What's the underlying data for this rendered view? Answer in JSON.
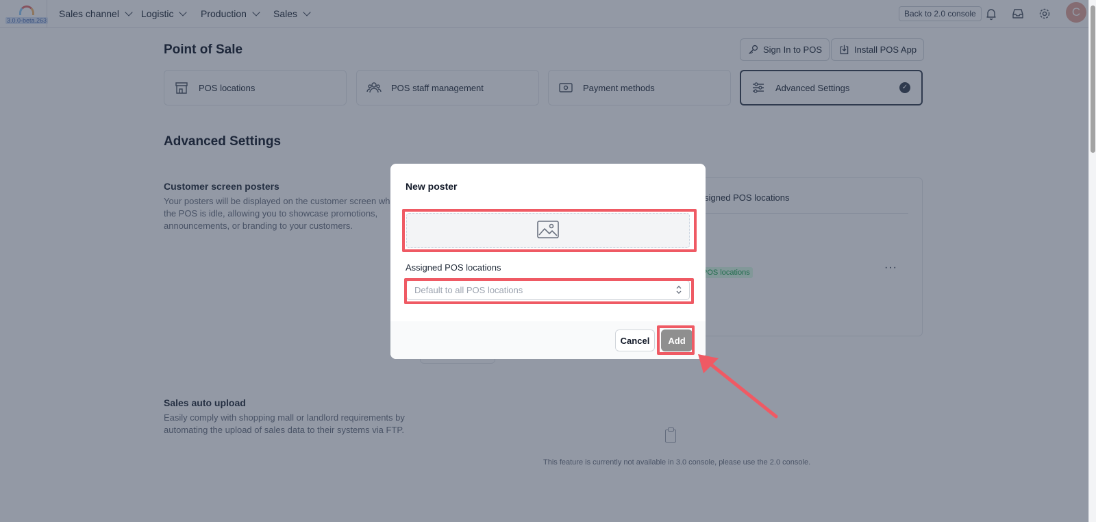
{
  "topbar": {
    "version": "3.0.0-beta.263",
    "nav": [
      {
        "label": "Sales channel"
      },
      {
        "label": "Logistic"
      },
      {
        "label": "Production"
      },
      {
        "label": "Sales"
      }
    ],
    "back_label": "Back to 2.0 console",
    "avatar_letter": "C"
  },
  "page": {
    "title": "Point of Sale",
    "sign_in_label": "Sign In to POS",
    "install_label": "Install POS App",
    "cards": [
      {
        "label": "POS locations",
        "icon": "store-icon"
      },
      {
        "label": "POS staff management",
        "icon": "users-icon"
      },
      {
        "label": "Payment methods",
        "icon": "payment-icon"
      },
      {
        "label": "Advanced Settings",
        "icon": "sliders-icon",
        "active": true
      }
    ],
    "section_title": "Advanced Settings",
    "posters": {
      "title": "Customer screen posters",
      "description": "Your posters will be displayed on the customer screen when the POS is idle, allowing you to showcase promotions, announcements, or branding to your customers.",
      "column_header": "Assigned POS locations",
      "tag": "POS locations"
    },
    "auto_upload": {
      "title": "Sales auto upload",
      "description": "Easily comply with shopping mall or landlord requirements by automating the upload of sales data to their systems via FTP.",
      "empty_text": "This feature is currently not available in 3.0 console, please use the 2.0 console."
    }
  },
  "modal": {
    "title": "New poster",
    "field_label": "Assigned POS locations",
    "select_placeholder": "Default to all POS locations",
    "cancel_label": "Cancel",
    "add_label": "Add"
  },
  "colors": {
    "highlight": "#ef5a64",
    "overlay": "rgba(40, 52, 76, 0.5)",
    "add_button": "#8f8f8f"
  }
}
